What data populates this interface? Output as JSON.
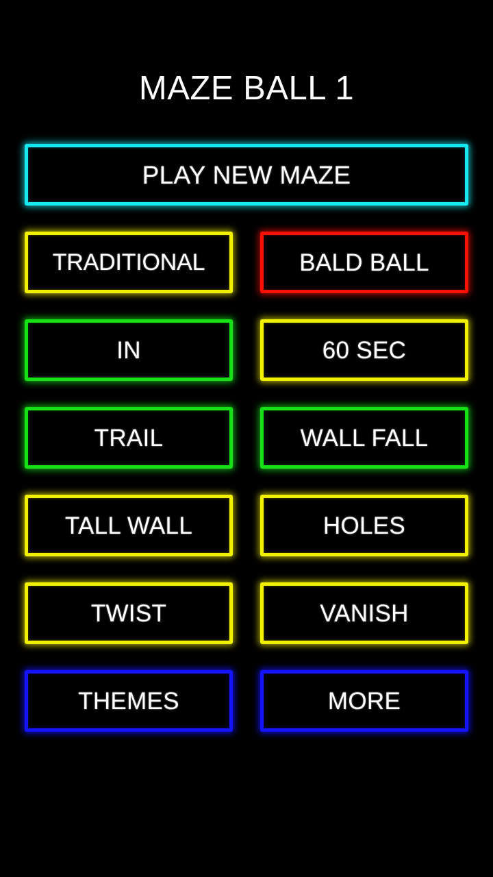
{
  "app": {
    "title": "MAZE BALL 1",
    "background_color": "#000000",
    "text_color": "#ffffff"
  },
  "palette": {
    "cyan": "#18e8f0",
    "yellow": "#f2f200",
    "red": "#f81000",
    "green": "#16e016",
    "blue": "#1414ff"
  },
  "menu": {
    "primary": {
      "label": "PLAY NEW MAZE",
      "color": "#18e8f0"
    },
    "rows": [
      {
        "left": {
          "label": "TRADITIONAL",
          "color": "#f2f200"
        },
        "right": {
          "label": "BALD BALL",
          "color": "#f81000"
        }
      },
      {
        "left": {
          "label": "IN",
          "color": "#16e016"
        },
        "right": {
          "label": "60 SEC",
          "color": "#f2f200"
        }
      },
      {
        "left": {
          "label": "TRAIL",
          "color": "#16e016"
        },
        "right": {
          "label": "WALL FALL",
          "color": "#16e016"
        }
      },
      {
        "left": {
          "label": "TALL WALL",
          "color": "#f2f200"
        },
        "right": {
          "label": "HOLES",
          "color": "#f2f200"
        }
      },
      {
        "left": {
          "label": "TWIST",
          "color": "#f2f200"
        },
        "right": {
          "label": "VANISH",
          "color": "#f2f200"
        }
      },
      {
        "left": {
          "label": "THEMES",
          "color": "#1414ff"
        },
        "right": {
          "label": "MORE",
          "color": "#1414ff"
        }
      }
    ]
  }
}
